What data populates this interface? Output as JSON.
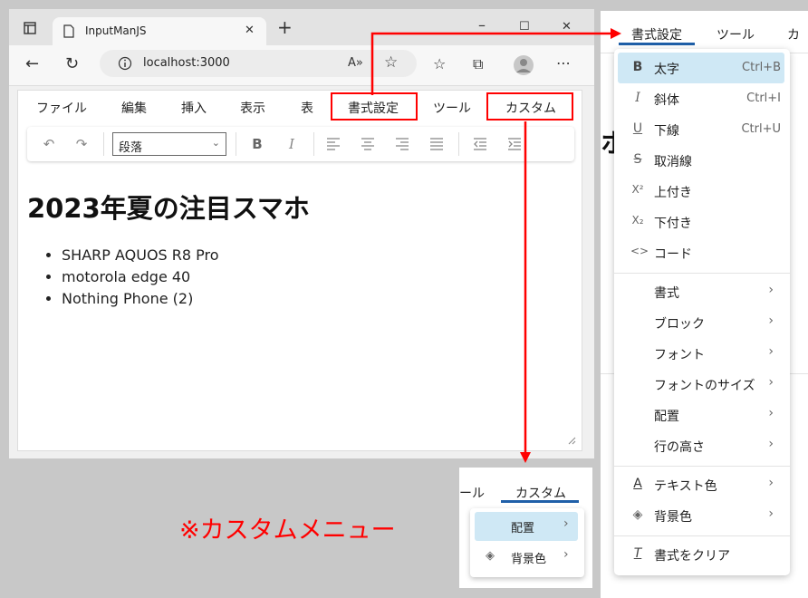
{
  "browser": {
    "tab_title": "InputManJS",
    "url": "localhost:3000",
    "window_controls": {
      "minimize": "–",
      "maximize": "☐",
      "close": "✕"
    }
  },
  "editor": {
    "menubar": [
      "ファイル",
      "編集",
      "挿入",
      "表示",
      "表",
      "書式設定",
      "ツール",
      "カスタム"
    ],
    "paragraph_select": "段落",
    "heading": "2023年夏の注目スマホ",
    "list": [
      "SHARP AQUOS R8 Pro",
      "motorola edge 40",
      "Nothing Phone (2)"
    ]
  },
  "format_menu": {
    "top_tabs": [
      "書式設定",
      "ツール",
      "カ"
    ],
    "items": [
      {
        "icon": "B",
        "label": "太字",
        "shortcut": "Ctrl+B"
      },
      {
        "icon": "I",
        "label": "斜体",
        "shortcut": "Ctrl+I"
      },
      {
        "icon": "U",
        "label": "下線",
        "shortcut": "Ctrl+U"
      },
      {
        "icon": "S",
        "label": "取消線"
      },
      {
        "icon": "X²",
        "label": "上付き"
      },
      {
        "icon": "X₂",
        "label": "下付き"
      },
      {
        "icon": "<>",
        "label": "コード"
      },
      {
        "label": "書式"
      },
      {
        "label": "ブロック"
      },
      {
        "label": "フォント"
      },
      {
        "label": "フォントのサイズ"
      },
      {
        "label": "配置"
      },
      {
        "label": "行の高さ"
      },
      {
        "icon": "A",
        "label": "テキスト色"
      },
      {
        "icon": "◈",
        "label": "背景色"
      },
      {
        "icon": "T",
        "label": "書式をクリア"
      }
    ],
    "side_glyph": "ホ"
  },
  "custom_menu": {
    "tab_partial": "ール",
    "tab": "カスタム",
    "items": [
      "配置",
      "背景色"
    ]
  },
  "annotation": "※カスタムメニュー",
  "colors": {
    "annotation_red": "#ff0000",
    "active_blue": "#cfe8f5",
    "tab_underline": "#1f5fa8"
  }
}
